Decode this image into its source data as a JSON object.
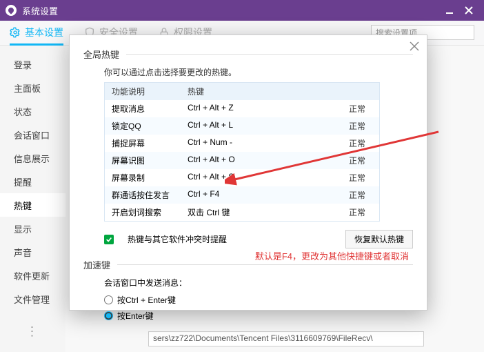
{
  "window": {
    "title": "系统设置"
  },
  "tabs": {
    "basic": "基本设置",
    "security": "安全设置",
    "permission": "权限设置",
    "search_placeholder": "搜索设置项"
  },
  "sidebar": {
    "items": [
      "登录",
      "主面板",
      "状态",
      "会话窗口",
      "信息展示",
      "提醒",
      "热键",
      "显示",
      "声音",
      "软件更新",
      "文件管理"
    ],
    "active_index": 6
  },
  "modal": {
    "section_global": "全局热键",
    "desc": "你可以通过点击选择要更改的热键。",
    "table": {
      "headers": [
        "功能说明",
        "热键",
        ""
      ],
      "rows": [
        {
          "fn": "提取消息",
          "key": "Ctrl + Alt + Z",
          "status": "正常"
        },
        {
          "fn": "锁定QQ",
          "key": "Ctrl + Alt + L",
          "status": "正常"
        },
        {
          "fn": "捕捉屏幕",
          "key": "Ctrl + Num -",
          "status": "正常"
        },
        {
          "fn": "屏幕识图",
          "key": "Ctrl + Alt + O",
          "status": "正常"
        },
        {
          "fn": "屏幕录制",
          "key": "Ctrl + Alt + S",
          "status": "正常"
        },
        {
          "fn": "群通话按住发言",
          "key": "Ctrl + F4",
          "status": "正常"
        },
        {
          "fn": "开启划词搜索",
          "key": "双击 Ctrl 键",
          "status": "正常"
        }
      ]
    },
    "conflict_checkbox": "热键与其它软件冲突时提醒",
    "restore_button": "恢复默认热键",
    "section_accel": "加速键",
    "send_label": "会话窗口中发送消息：",
    "radio_ctrl_enter": "按Ctrl + Enter键",
    "radio_enter": "按Enter键",
    "note": "默认是F4，更改为其他快捷键或者取消"
  },
  "path": "sers\\zz722\\Documents\\Tencent Files\\3116609769\\FileRecv\\"
}
